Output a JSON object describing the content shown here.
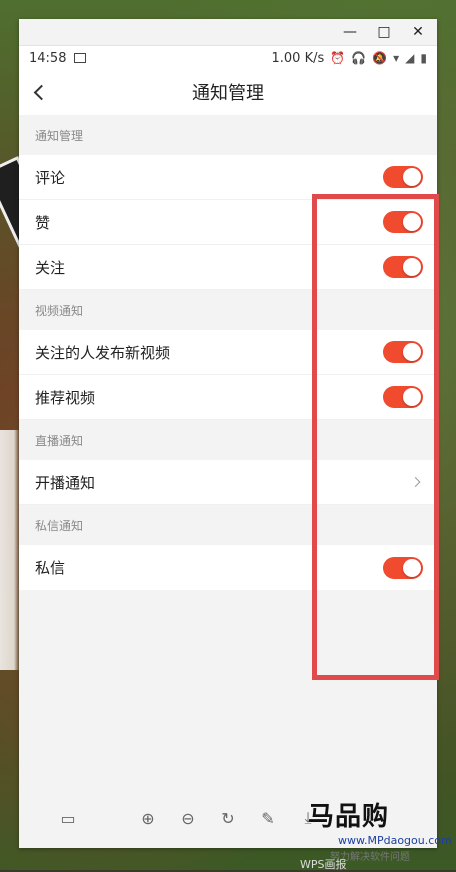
{
  "status_bar": {
    "time": "14:58",
    "network_speed": "1.00 K/s",
    "icons": [
      "gallery-icon",
      "alarm-icon",
      "headphone-icon",
      "mute-icon",
      "wifi-icon",
      "signal-icon",
      "battery-icon"
    ]
  },
  "header": {
    "title": "通知管理"
  },
  "sections": [
    {
      "title": "通知管理",
      "items": [
        {
          "label": "评论",
          "control": "toggle",
          "enabled": true
        },
        {
          "label": "赞",
          "control": "toggle",
          "enabled": true
        },
        {
          "label": "关注",
          "control": "toggle",
          "enabled": true
        }
      ]
    },
    {
      "title": "视频通知",
      "items": [
        {
          "label": "关注的人发布新视频",
          "control": "toggle",
          "enabled": true
        },
        {
          "label": "推荐视频",
          "control": "toggle",
          "enabled": true
        }
      ]
    },
    {
      "title": "直播通知",
      "items": [
        {
          "label": "开播通知",
          "control": "chevron"
        }
      ]
    },
    {
      "title": "私信通知",
      "items": [
        {
          "label": "私信",
          "control": "toggle",
          "enabled": true
        }
      ]
    }
  ],
  "colors": {
    "toggle_on": "#f04a2f",
    "highlight": "#e04a4a"
  },
  "watermark": {
    "brand": "马品购",
    "url": "www.MPdaogou.com",
    "tagline": "努力解决软件问题",
    "bottom": "WPS画报"
  }
}
